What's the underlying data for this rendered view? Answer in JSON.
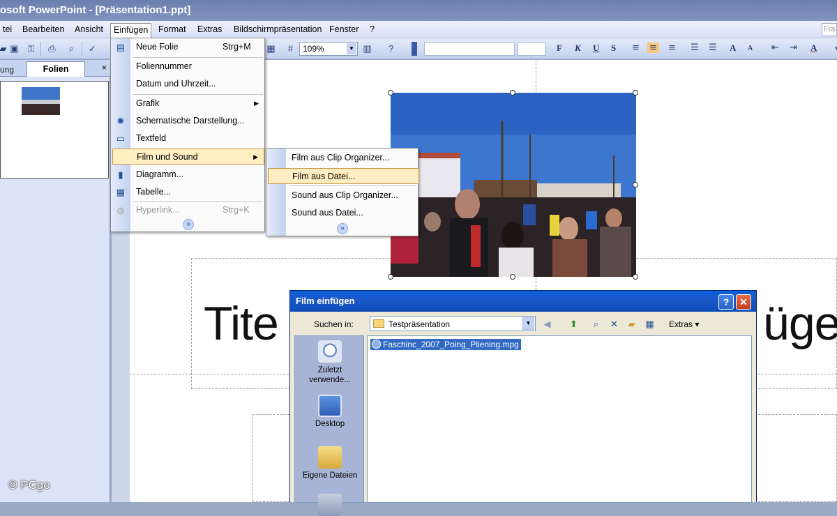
{
  "window": {
    "title": "osoft PowerPoint - [Präsentation1.ppt]"
  },
  "menubar": {
    "items": [
      "tei",
      "Bearbeiten",
      "Ansicht",
      "Einfügen",
      "Format",
      "Extras",
      "Bildschirmpräsentation",
      "Fenster",
      "?"
    ],
    "help_placeholder": "Fra"
  },
  "toolbar": {
    "zoom": "109%"
  },
  "leftpane": {
    "tab_outline": "ung",
    "tab_slides": "Folien",
    "close": "×"
  },
  "slide": {
    "title_left": "Tite",
    "title_right": "üge"
  },
  "insert_menu": {
    "items": [
      {
        "label": "Neue Folie",
        "shortcut": "Strg+M",
        "icon": "new-slide-icon"
      },
      {
        "label": "Foliennummer"
      },
      {
        "label": "Datum und Uhrzeit..."
      },
      {
        "label": "Grafik",
        "submenu": true
      },
      {
        "label": "Schematische Darstellung...",
        "icon": "diagram-gallery-icon"
      },
      {
        "label": "Textfeld",
        "icon": "textbox-icon"
      },
      {
        "label": "Film und Sound",
        "submenu": true,
        "highlighted": true
      },
      {
        "label": "Diagramm...",
        "icon": "chart-icon"
      },
      {
        "label": "Tabelle...",
        "icon": "table-icon"
      },
      {
        "label": "Hyperlink...",
        "shortcut": "Strg+K",
        "disabled": true,
        "icon": "hyperlink-icon"
      }
    ]
  },
  "film_menu": {
    "items": [
      {
        "label": "Film aus Clip Organizer..."
      },
      {
        "label": "Film aus Datei...",
        "highlighted": true
      },
      {
        "label": "Sound aus Clip Organizer..."
      },
      {
        "label": "Sound aus Datei..."
      }
    ]
  },
  "dialog": {
    "title": "Film einfügen",
    "help": "?",
    "close": "✕",
    "lookin_label": "Suchen in:",
    "lookin_value": "Testpräsentation",
    "extras": "Extras",
    "places": [
      {
        "label": "Zuletzt verwende...",
        "icon": "recent-documents-icon"
      },
      {
        "label": "Desktop",
        "icon": "desktop-icon"
      },
      {
        "label": "Eigene Dateien",
        "icon": "my-documents-icon"
      }
    ],
    "files": [
      {
        "name": "Faschinc_2007_Poing_Pliening.mpg",
        "selected": true
      }
    ]
  },
  "watermark": "© PCgo",
  "colors": {
    "menu_highlight": "#ffeec2",
    "dialog_title": "#0a5fdc",
    "selection": "#316ac5"
  }
}
